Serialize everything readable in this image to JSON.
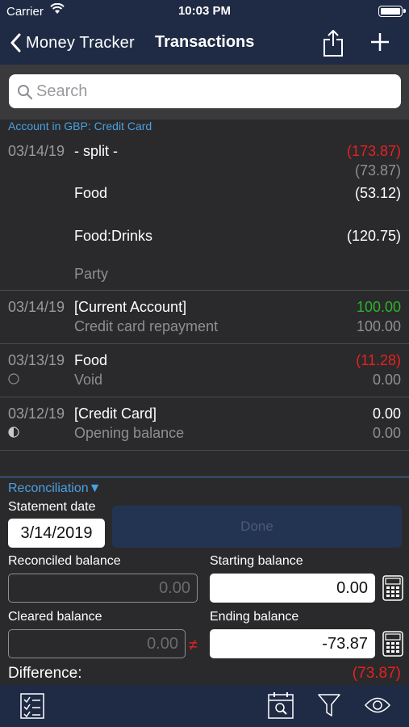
{
  "status_bar": {
    "carrier": "Carrier",
    "time": "10:03 PM"
  },
  "nav": {
    "back_label": "Money Tracker",
    "title": "Transactions"
  },
  "search": {
    "placeholder": "Search"
  },
  "account_header": "Account in GBP: Credit Card",
  "transactions": [
    {
      "date": "03/14/19",
      "payee": "- split -",
      "amount": "(173.87)",
      "amount_color": "#e8211f",
      "balance": "(73.87)",
      "splits": [
        {
          "category": "Food",
          "amount": "(53.12)"
        },
        {
          "category": "Food:Drinks",
          "amount": "(120.75)"
        }
      ],
      "memo": "Party"
    },
    {
      "date": "03/14/19",
      "payee": "[Current Account]",
      "sub": "Credit card repayment",
      "amount": "100.00",
      "amount_color": "#2cb32b",
      "balance": "100.00"
    },
    {
      "date": "03/13/19",
      "payee": "Food",
      "sub": "Void",
      "amount": "(11.28)",
      "amount_color": "#e8211f",
      "balance": "0.00",
      "status_icon": "empty-circle-icon"
    },
    {
      "date": "03/12/19",
      "payee": "[Credit Card]",
      "sub": "Opening balance",
      "amount": "0.00",
      "amount_color": "#ffffff",
      "balance": "0.00",
      "status_icon": "half-circle-icon"
    }
  ],
  "reconciliation": {
    "title": "Reconciliation▼",
    "statement_date_label": "Statement date",
    "statement_date": "3/14/2019",
    "done_label": "Done",
    "reconciled_label": "Reconciled balance",
    "reconciled_value": "0.00",
    "starting_label": "Starting balance",
    "starting_value": "0.00",
    "cleared_label": "Cleared balance",
    "cleared_value": "0.00",
    "neq_symbol": "≠",
    "ending_label": "Ending balance",
    "ending_value": "-73.87",
    "difference_label": "Difference:",
    "difference_value": "(73.87)"
  },
  "toolbar": {
    "icons": [
      "checklist-icon",
      "calendar-search-icon",
      "filter-icon",
      "eye-icon"
    ]
  },
  "colors": {
    "nav_bg": "#1f2b45",
    "accent": "#4aa0e0",
    "negative": "#e8211f",
    "positive": "#2cb32b"
  }
}
